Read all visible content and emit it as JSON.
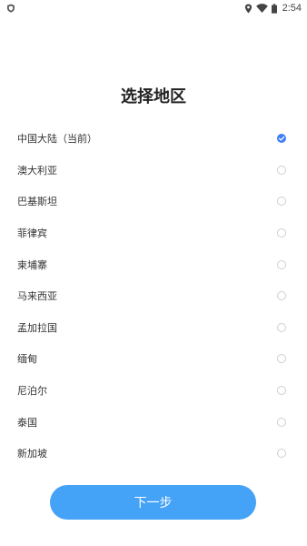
{
  "status_bar": {
    "time": "2:54",
    "icons": [
      "shield-icon",
      "location-pin-icon",
      "wifi-icon",
      "battery-icon"
    ]
  },
  "title": "选择地区",
  "regions": [
    {
      "label": "中国大陆（当前）",
      "selected": true
    },
    {
      "label": "澳大利亚",
      "selected": false
    },
    {
      "label": "巴基斯坦",
      "selected": false
    },
    {
      "label": "菲律宾",
      "selected": false
    },
    {
      "label": "柬埔寨",
      "selected": false
    },
    {
      "label": "马来西亚",
      "selected": false
    },
    {
      "label": "孟加拉国",
      "selected": false
    },
    {
      "label": "缅甸",
      "selected": false
    },
    {
      "label": "尼泊尔",
      "selected": false
    },
    {
      "label": "泰国",
      "selected": false
    },
    {
      "label": "新加坡",
      "selected": false
    }
  ],
  "next_button_label": "下一步",
  "colors": {
    "accent": "#3f7ef5",
    "button": "#44a2f7"
  }
}
